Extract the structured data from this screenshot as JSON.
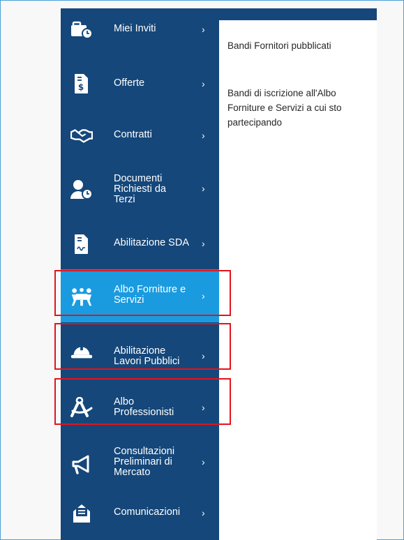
{
  "menu": {
    "items": [
      {
        "id": "miei-inviti",
        "label": "Miei Inviti",
        "icon": "briefcase-clock-icon",
        "active": false
      },
      {
        "id": "offerte",
        "label": "Offerte",
        "icon": "dollar-document-icon",
        "active": false
      },
      {
        "id": "contratti",
        "label": "Contratti",
        "icon": "handshake-icon",
        "active": false
      },
      {
        "id": "documenti",
        "label": "Documenti\nRichiesti da\nTerzi",
        "icon": "user-clock-icon",
        "active": false
      },
      {
        "id": "abilitazione-sda",
        "label": "Abilitazione SDA",
        "icon": "signed-document-icon",
        "active": false
      },
      {
        "id": "albo-forniture",
        "label": "Albo Forniture e\nServizi",
        "icon": "people-table-icon",
        "active": true
      },
      {
        "id": "abilitazione-lavori",
        "label": "Abilitazione\nLavori Pubblici",
        "icon": "hard-hat-icon",
        "active": false
      },
      {
        "id": "albo-professionisti",
        "label": "Albo\nProfessionisti",
        "icon": "drafting-compass-icon",
        "active": false
      },
      {
        "id": "consultazioni",
        "label": "Consultazioni\nPreliminari di\nMercato",
        "icon": "megaphone-icon",
        "active": false
      },
      {
        "id": "comunicazioni",
        "label": "Comunicazioni",
        "icon": "envelope-message-icon",
        "active": false
      }
    ],
    "chevron": "›"
  },
  "panel": {
    "line1": "Bandi Fornitori pubblicati",
    "line2": "Bandi di iscrizione all'Albo Forniture e Servizi a cui sto partecipando"
  },
  "colors": {
    "sidebar": "#15477a",
    "active": "#1a9be0",
    "highlight": "#e3141b"
  }
}
